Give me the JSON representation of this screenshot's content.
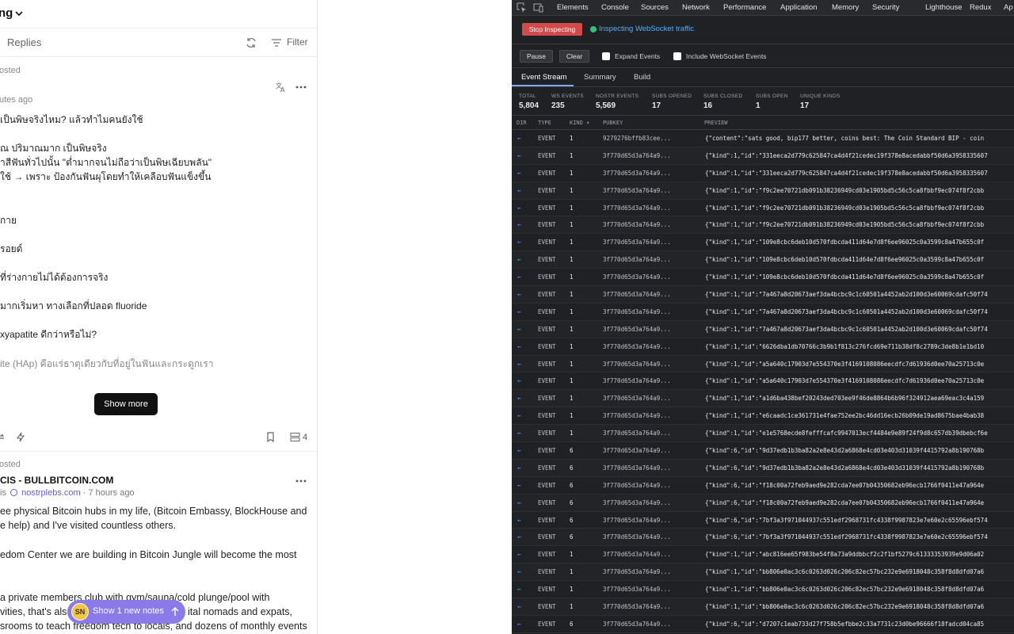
{
  "feed": {
    "title": "ng",
    "tabs": {
      "replies": "Replies",
      "filter": "Filter"
    },
    "post1": {
      "reposted": "osted",
      "time": "utes ago",
      "lines": [
        "เป็นพิษจริงไหม? แล้วทำไมคนยังใช้",
        "",
        "ณ ปริมาณมาก เป็นพิษจริง",
        "าสีฟันทั่วไปนั้น \"ต่ำมากจนไม่ถือว่าเป็นพิษเฉียบพลัน\"",
        "ใช้ → เพราะ ป้องกันฟันผุโดยทำให้เคลือบฟันแข็งขึ้น",
        "กาย",
        "รอยด์",
        "ที่ร่างกายไม่ได้ต้องการจริง",
        "มากเริ่มหา ทางเลือกที่ปลอด fluoride",
        "xyapatite ดีกว่าหรือไม่?",
        "ite (HAp) คือแร่ธาตุเดียวกับที่อยู่ในฟันและกระดูกเรา"
      ],
      "show_more": "Show more",
      "thread_count": "4"
    },
    "post2": {
      "reposted": "osted",
      "author": "CIS - BULLBITCOIN.COM",
      "handle_prefix": "is",
      "nip05": "nostrplebs.com",
      "time": "· 7 hours ago",
      "lines": [
        "ee physical Bitcoin hubs in my life, (Bitcoin Embassy, BlockHouse and",
        "e help) and I've visited countless others.",
        "edom Center we are building in Bitcoin Jungle will become the most",
        "a private members club with gym/sauna/cold plunge/pool with",
        "vities, that's als",
        "ital nomads and expats,",
        "srooms to teach freedom tech to locals, and dozens of monthly events"
      ]
    },
    "new_notes": {
      "avatar_text": "SN",
      "label": "Show 1 new notes"
    }
  },
  "devtools": {
    "tabs": [
      "Elements",
      "Console",
      "Sources",
      "Network",
      "Performance",
      "Application",
      "Memory",
      "Security",
      "Lighthouse",
      "Redux",
      "Ap"
    ],
    "stop_button": "Stop Inspecting",
    "live_label": "Inspecting WebSocket traffic",
    "pause": "Pause",
    "clear": "Clear",
    "expand_events": "Expand Events",
    "include_ws": "Include WebSocket Events",
    "subtabs": [
      "Event Stream",
      "Summary",
      "Build"
    ],
    "stats": [
      {
        "label": "TOTAL",
        "value": "5,804"
      },
      {
        "label": "WS EVENTS",
        "value": "235"
      },
      {
        "label": "NOSTR EVENTS",
        "value": "5,569"
      },
      {
        "label": "SUBS OPENED",
        "value": "17"
      },
      {
        "label": "SUBS CLOSED",
        "value": "16"
      },
      {
        "label": "SUBS OPEN",
        "value": "1"
      },
      {
        "label": "UNIQUE KINDS",
        "value": "17"
      }
    ],
    "columns": {
      "dir": "DIR",
      "type": "TYPE",
      "kind": "KIND ▾",
      "pubkey": "PUBKEY",
      "preview": "PREVIEW"
    },
    "rows": [
      {
        "dir": "←",
        "type": "EVENT",
        "kind": "1",
        "pubkey": "9279276bffb83cee...",
        "preview": "{\"content\":\"sats good, bip177 better, coins best: The Coin Standard BIP - coin"
      },
      {
        "dir": "←",
        "type": "EVENT",
        "kind": "1",
        "pubkey": "3f770d65d3a764a9...",
        "preview": "{\"kind\":1,\"id\":\"331eeca2d779c625847ca4d4f21cedec19f378e8acedabbf50d6a3958335607"
      },
      {
        "dir": "←",
        "type": "EVENT",
        "kind": "1",
        "pubkey": "3f770d65d3a764a9...",
        "preview": "{\"kind\":1,\"id\":\"331eeca2d779c625847ca4d4f21cedec19f378e8acedabbf50d6a3958335607"
      },
      {
        "dir": "←",
        "type": "EVENT",
        "kind": "1",
        "pubkey": "3f770d65d3a764a9...",
        "preview": "{\"kind\":1,\"id\":\"f9c2ee70721db091b38236949cd03e1905bd5c56c5ca8fbbf9ec074f8f2cbb"
      },
      {
        "dir": "←",
        "type": "EVENT",
        "kind": "1",
        "pubkey": "3f770d65d3a764a9...",
        "preview": "{\"kind\":1,\"id\":\"f9c2ee70721db091b38236949cd03e1905bd5c56c5ca8fbbf9ec074f8f2cbb"
      },
      {
        "dir": "←",
        "type": "EVENT",
        "kind": "1",
        "pubkey": "3f770d65d3a764a9...",
        "preview": "{\"kind\":1,\"id\":\"f9c2ee70721db091b38236949cd03e1905bd5c56c5ca8fbbf9ec074f8f2cbb"
      },
      {
        "dir": "←",
        "type": "EVENT",
        "kind": "1",
        "pubkey": "3f770d65d3a764a9...",
        "preview": "{\"kind\":1,\"id\":\"109e8cbc6deb10d570fdbcda411d64e7d8f6ee96025c0a3599c8a47b655c0f"
      },
      {
        "dir": "←",
        "type": "EVENT",
        "kind": "1",
        "pubkey": "3f770d65d3a764a9...",
        "preview": "{\"kind\":1,\"id\":\"109e8cbc6deb10d570fdbcda411d64e7d8f6ee96025c0a3599c8a47b655c0f"
      },
      {
        "dir": "←",
        "type": "EVENT",
        "kind": "1",
        "pubkey": "3f770d65d3a764a9...",
        "preview": "{\"kind\":1,\"id\":\"109e8cbc6deb10d570fdbcda411d64e7d8f6ee96025c0a3599c8a47b655c0f"
      },
      {
        "dir": "←",
        "type": "EVENT",
        "kind": "1",
        "pubkey": "3f770d65d3a764a9...",
        "preview": "{\"kind\":1,\"id\":\"7a467a8d20673aef3da4bcbc9c1c60501a4452ab2d100d3e60069cdafc50f74"
      },
      {
        "dir": "←",
        "type": "EVENT",
        "kind": "1",
        "pubkey": "3f770d65d3a764a9...",
        "preview": "{\"kind\":1,\"id\":\"7a467a8d20673aef3da4bcbc9c1c60501a4452ab2d100d3e60069cdafc50f74"
      },
      {
        "dir": "←",
        "type": "EVENT",
        "kind": "1",
        "pubkey": "3f770d65d3a764a9...",
        "preview": "{\"kind\":1,\"id\":\"7a467a8d20673aef3da4bcbc9c1c60501a4452ab2d100d3e60069cdafc50f74"
      },
      {
        "dir": "←",
        "type": "EVENT",
        "kind": "1",
        "pubkey": "3f770d65d3a764a9...",
        "preview": "{\"kind\":1,\"id\":\"6626dba1db70766c3b9b1f813c276fcd69e711b38df8c2789c3de8b1e1bd10"
      },
      {
        "dir": "←",
        "type": "EVENT",
        "kind": "1",
        "pubkey": "3f770d65d3a764a9...",
        "preview": "{\"kind\":1,\"id\":\"a5a640c17903d7e554370e3f4169108086eecdfc7d61936d0ee70a25713c0e"
      },
      {
        "dir": "←",
        "type": "EVENT",
        "kind": "1",
        "pubkey": "3f770d65d3a764a9...",
        "preview": "{\"kind\":1,\"id\":\"a5a640c17903d7e554370e3f4169108086eecdfc7d61936d0ee70a25713c0e"
      },
      {
        "dir": "←",
        "type": "EVENT",
        "kind": "1",
        "pubkey": "3f770d65d3a764a9...",
        "preview": "{\"kind\":1,\"id\":\"a1d6ba438bef20243ded703ee9f46de8864b6b96f324912aea69eac3c4a159"
      },
      {
        "dir": "←",
        "type": "EVENT",
        "kind": "1",
        "pubkey": "3f770d65d3a764a9...",
        "preview": "{\"kind\":1,\"id\":\"e6caadc1ce361731e4fae752ee2bc46dd16ecb26b09de19ad8675bae4bab38"
      },
      {
        "dir": "←",
        "type": "EVENT",
        "kind": "1",
        "pubkey": "3f770d65d3a764a9...",
        "preview": "{\"kind\":1,\"id\":\"e1e5768ecde8fefffcafc9947013ecf4484e9e89f24f9d8c657db39dbebcf6e"
      },
      {
        "dir": "←",
        "type": "EVENT",
        "kind": "6",
        "pubkey": "3f770d65d3a764a9...",
        "preview": "{\"kind\":6,\"id\":\"9d37edb1b3ba82a2e8e43d2a6868e4cd03e403d31039f4415792a8b190768b"
      },
      {
        "dir": "←",
        "type": "EVENT",
        "kind": "6",
        "pubkey": "3f770d65d3a764a9...",
        "preview": "{\"kind\":6,\"id\":\"9d37edb1b3ba82a2e8e43d2a6868e4cd03e403d31039f4415792a8b190768b"
      },
      {
        "dir": "←",
        "type": "EVENT",
        "kind": "6",
        "pubkey": "3f770d65d3a764a9...",
        "preview": "{\"kind\":6,\"id\":\"f18c00a72feb9aed9e282cda7ee07b04350682eb96ecb1766f0411e47a964e"
      },
      {
        "dir": "←",
        "type": "EVENT",
        "kind": "6",
        "pubkey": "3f770d65d3a764a9...",
        "preview": "{\"kind\":6,\"id\":\"f18c00a72feb9aed9e282cda7ee07b04350682eb96ecb1766f0411e47a964e"
      },
      {
        "dir": "←",
        "type": "EVENT",
        "kind": "6",
        "pubkey": "3f770d65d3a764a9...",
        "preview": "{\"kind\":6,\"id\":\"7bf3a3f971044937c551edf2968731fc4338f9987823e7e60e2c65596ebf574"
      },
      {
        "dir": "←",
        "type": "EVENT",
        "kind": "6",
        "pubkey": "3f770d65d3a764a9...",
        "preview": "{\"kind\":6,\"id\":\"7bf3a3f971044937c551edf2968731fc4338f9987823e7e60e2c65596ebf574"
      },
      {
        "dir": "←",
        "type": "EVENT",
        "kind": "1",
        "pubkey": "3f770d65d3a764a9...",
        "preview": "{\"kind\":1,\"id\":\"abc816ee65f983be54f8a73a9ddbbcf2c2f1bf5279c61333353939e9d06a02"
      },
      {
        "dir": "←",
        "type": "EVENT",
        "kind": "1",
        "pubkey": "3f770d65d3a764a9...",
        "preview": "{\"kind\":1,\"id\":\"bb806e0ac3c6c0263d026c206c82ec57bc232e9e6918048c358f8d8dfd07a6"
      },
      {
        "dir": "←",
        "type": "EVENT",
        "kind": "1",
        "pubkey": "3f770d65d3a764a9...",
        "preview": "{\"kind\":1,\"id\":\"bb806e0ac3c6c0263d026c206c82ec57bc232e9e6918048c358f8d8dfd07a6"
      },
      {
        "dir": "←",
        "type": "EVENT",
        "kind": "1",
        "pubkey": "3f770d65d3a764a9...",
        "preview": "{\"kind\":1,\"id\":\"bb806e0ac3c6c0263d026c206c82ec57bc232e9e6918048c358f8d8dfd07a6"
      },
      {
        "dir": "←",
        "type": "EVENT",
        "kind": "6",
        "pubkey": "3f770d65d3a764a9...",
        "preview": "{\"kind\":6,\"id\":\"d7207c1eab733d27f758b5efbbe2c33a7731c23d0be96666f18fadcd04ca85"
      }
    ]
  }
}
